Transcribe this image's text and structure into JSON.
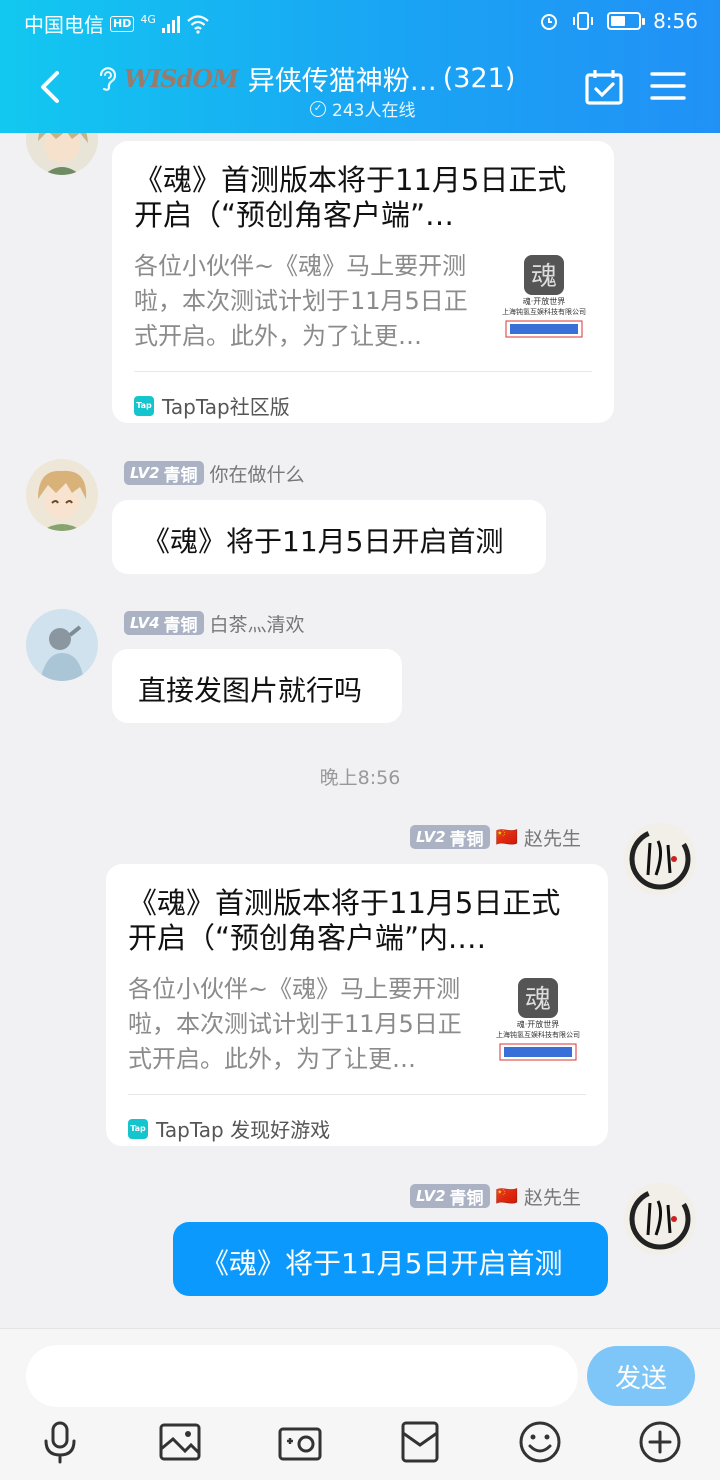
{
  "status_bar": {
    "carrier": "中国电信",
    "hd": "HD",
    "network": "4G",
    "time": "8:56"
  },
  "header": {
    "logo_text": "WISdOM",
    "title": "异侠传猫神粉…",
    "member_count": "(321)",
    "online": "243人在线",
    "icons": [
      "back-chevron-icon",
      "ear-icon",
      "calendar-check-icon",
      "menu-icon"
    ]
  },
  "messages": {
    "m1": {
      "card_title": "《魂》首测版本将于11月5日正式开启（“预创角客户端”…",
      "card_desc": "各位小伙伴~《魂》马上要开测啦，本次测试计划于11月5日正式开启。此外，为了让更…",
      "thumb_text": "魂·开放世界",
      "thumb_company": "上海钝氢互娱科技有限公司",
      "source": "TapTap社区版"
    },
    "m2": {
      "level": "LV2",
      "rank": "青铜",
      "sender": "你在做什么",
      "text": "《魂》将于11月5日开启首测"
    },
    "m3": {
      "level": "LV4",
      "rank": "青铜",
      "sender": "白茶灬清欢",
      "text": "直接发图片就行吗"
    },
    "time_separator": "晚上8:56",
    "m4": {
      "level": "LV2",
      "rank": "青铜",
      "flag": "🇨🇳",
      "sender": "赵先生",
      "card_title": "《魂》首测版本将于11月5日正式开启（“预创角客户端”内.…",
      "card_desc": "各位小伙伴~《魂》马上要开测啦，本次测试计划于11月5日正式开启。此外，为了让更…",
      "thumb_text": "魂·开放世界",
      "thumb_company": "上海钝氢互娱科技有限公司",
      "source": "TapTap 发现好游戏"
    },
    "m5": {
      "level": "LV2",
      "rank": "青铜",
      "flag": "🇨🇳",
      "sender": "赵先生",
      "text": "《魂》将于11月5日开启首测"
    }
  },
  "input_bar": {
    "placeholder": "",
    "send_label": "发送",
    "tools": [
      "microphone-icon",
      "image-icon",
      "camera-icon",
      "red-packet-icon",
      "emoji-icon",
      "plus-icon"
    ]
  },
  "colors": {
    "header_start": "#12c8f0",
    "header_end": "#2191f6",
    "my_bubble": "#0b99fd",
    "send_button": "#7fc6f8",
    "level_badge": "#aab2c4"
  }
}
